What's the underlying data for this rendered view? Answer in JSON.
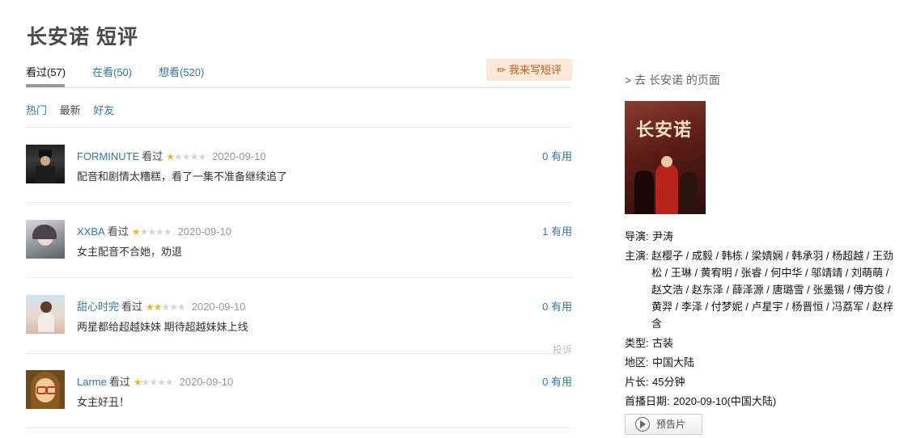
{
  "page_title": "长安诺 短评",
  "tabs": [
    {
      "label": "看过(57)",
      "active": true
    },
    {
      "label": "在看(50)",
      "active": false
    },
    {
      "label": "想看(520)",
      "active": false
    }
  ],
  "write_button": "我来写短评",
  "sorts": [
    "热门",
    "最新",
    "好友"
  ],
  "comments": [
    {
      "user": "FORMINUTE",
      "status": "看过",
      "rating": 1,
      "date": "2020-09-10",
      "text": "配音和剧情太糟糕，看了一集不准备继续追了",
      "useful": "0 有用"
    },
    {
      "user": "XXBA",
      "status": "看过",
      "rating": 1,
      "date": "2020-09-10",
      "text": "女主配音不合她，劝退",
      "useful": "1 有用"
    },
    {
      "user": "甜心时完",
      "status": "看过",
      "rating": 2,
      "date": "2020-09-10",
      "text": "两星都给超越妹妹 期待超越妹妹上线",
      "useful": "0 有用",
      "report": "投诉"
    },
    {
      "user": "Larme",
      "status": "看过",
      "rating": 1,
      "date": "2020-09-10",
      "text": "女主好丑！",
      "useful": "0 有用"
    }
  ],
  "sidebar": {
    "goto": "> 去 长安诺 的页面",
    "poster_title": "长安诺",
    "director_label": "导演:",
    "director": "尹涛",
    "cast_label": "主演:",
    "cast": "赵樱子 / 成毅 / 韩栋 / 梁婧娴 / 韩承羽 / 杨超越 / 王劲松 / 王琳 / 黄宥明 / 张睿 / 何中华 / 邬靖靖 / 刘萌萌 / 赵文浩 / 赵东泽 / 薛泽源 / 唐璐雪 / 张墨锡 / 傅方俊 / 黄羿 / 李泽 / 付梦妮 / 卢星宇 / 杨晋恒 / 冯荔军 / 赵梓含",
    "genre_label": "类型:",
    "genre": "古装",
    "region_label": "地区:",
    "region": "中国大陆",
    "length_label": "片长:",
    "length": "45分钟",
    "date_label": "首播日期:",
    "date": "2020-09-10(中国大陆)",
    "trailer": "预告片"
  },
  "colors": {
    "link": "#3377aa",
    "star": "#f6b526",
    "write_bg": "#fbe8d9"
  }
}
